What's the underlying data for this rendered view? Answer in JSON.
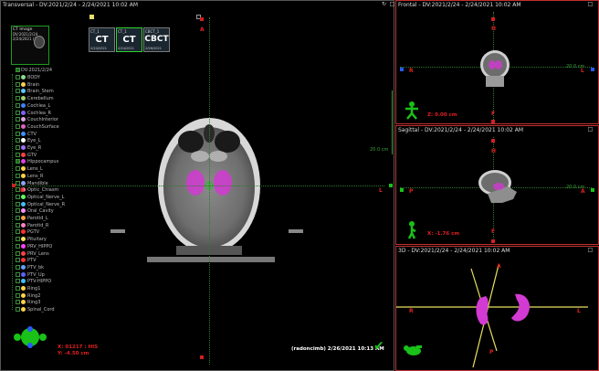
{
  "transversal": {
    "title": "Transversal - DV:2021/2/24 - 2/24/2021 10:02 AM",
    "label_top": "A",
    "label_left": "R",
    "label_right": "L",
    "scale": "20.0 cm",
    "info_line1": "X: 01217 : HIS",
    "info_line2": "Y: -4.50 cm",
    "user_stamp": "(radoncimb) 2/26/2021 10:13 AM"
  },
  "ct_image_panel": {
    "title": "CT Image",
    "line1": "DV:2021/2/24",
    "line2": "2/24/2021 (2)"
  },
  "thumbnails": [
    {
      "top_text": "CT_1",
      "big_label": "CT",
      "date": "2/24/2021",
      "selected": false
    },
    {
      "top_text": "CT_1",
      "big_label": "CT",
      "date": "2/24/2021",
      "selected": true
    },
    {
      "top_text": "CBCT_1",
      "big_label": "CBCT",
      "date": "2/26/2021",
      "selected": false
    }
  ],
  "structure_set": {
    "header": "DV:2021/2/24",
    "items": [
      {
        "name": "BODY",
        "color": "#8fdc8f",
        "checked": false
      },
      {
        "name": "Brain",
        "color": "#ffd24a",
        "checked": false
      },
      {
        "name": "Brain_Stem",
        "color": "#58c8ff",
        "checked": false
      },
      {
        "name": "Cerebellum",
        "color": "#a0d070",
        "checked": false
      },
      {
        "name": "Cochlea_L",
        "color": "#4080ff",
        "checked": false
      },
      {
        "name": "Cochlea_R",
        "color": "#8060ff",
        "checked": false
      },
      {
        "name": "CouchInterior",
        "color": "#e0a0e0",
        "checked": false
      },
      {
        "name": "CouchSurface",
        "color": "#e060c0",
        "checked": false
      },
      {
        "name": "CTV",
        "color": "#4090ff",
        "checked": false
      },
      {
        "name": "Eye_L",
        "color": "#ffffff",
        "checked": false
      },
      {
        "name": "Eye_R",
        "color": "#a070ff",
        "checked": false
      },
      {
        "name": "GTV",
        "color": "#ff4040",
        "checked": false
      },
      {
        "name": "Hippocampus",
        "color": "#e040e0",
        "checked": true
      },
      {
        "name": "Lens_L",
        "color": "#ffd24a",
        "checked": false
      },
      {
        "name": "Lens_R",
        "color": "#ffd24a",
        "checked": false
      },
      {
        "name": "Mandible",
        "color": "#90a0ff",
        "checked": false
      },
      {
        "name": "Optic_Chiasm",
        "color": "#ff70a0",
        "checked": false
      },
      {
        "name": "Optical_Nerve_L",
        "color": "#60ff60",
        "checked": false
      },
      {
        "name": "Optical_Nerve_R",
        "color": "#40c0ff",
        "checked": false
      },
      {
        "name": "Oral_Cavity",
        "color": "#ff90ff",
        "checked": false
      },
      {
        "name": "Parotid_L",
        "color": "#ffa040",
        "checked": false
      },
      {
        "name": "Parotid_R",
        "color": "#ff80c0",
        "checked": false
      },
      {
        "name": "PGTV",
        "color": "#ff3030",
        "checked": false
      },
      {
        "name": "Pituitary",
        "color": "#ffe060",
        "checked": false
      },
      {
        "name": "PRV_HIPPO",
        "color": "#ff40ff",
        "checked": false
      },
      {
        "name": "PRV_Lens",
        "color": "#ff4040",
        "checked": false
      },
      {
        "name": "PTV",
        "color": "#ff3030",
        "checked": false
      },
      {
        "name": "PTV_bk",
        "color": "#60a0ff",
        "checked": false
      },
      {
        "name": "PTV_Up",
        "color": "#6060ff",
        "checked": false
      },
      {
        "name": "PTV-HIPPO",
        "color": "#40c0ff",
        "checked": false
      },
      {
        "name": "Ring1",
        "color": "#ffd24a",
        "checked": false
      },
      {
        "name": "Ring2",
        "color": "#ffd24a",
        "checked": false
      },
      {
        "name": "Ring3",
        "color": "#ffd24a",
        "checked": false
      },
      {
        "name": "Spinal_Cord",
        "color": "#ffd24a",
        "checked": false
      }
    ]
  },
  "frontal": {
    "title": "Frontal - DV:2021/2/24 - 2/24/2021 10:02 AM",
    "label_top": "H",
    "label_left": "R",
    "label_right": "L",
    "label_bottom": "F",
    "scale": "20.0 cm",
    "coord": "Z: 0.00 cm"
  },
  "sagittal": {
    "title": "Sagittal - DV:2021/2/24 - 2/24/2021 10:02 AM",
    "label_top": "H",
    "label_left": "P",
    "label_right": "A",
    "label_bottom": "F",
    "scale": "20.0 cm",
    "coord": "X: -1.76 cm"
  },
  "view3d": {
    "title": "3D - DV:2021/2/24 - 2/24/2021 10:02 AM",
    "label_top": "A",
    "label_right": "L",
    "label_left": "R",
    "label_bottom": "P"
  },
  "colors": {
    "border": "#e02020",
    "accent_green": "#19c119",
    "orient_red": "#d02020",
    "orient_blue": "#2a59ff",
    "hippocampus": "#d23ad2"
  }
}
